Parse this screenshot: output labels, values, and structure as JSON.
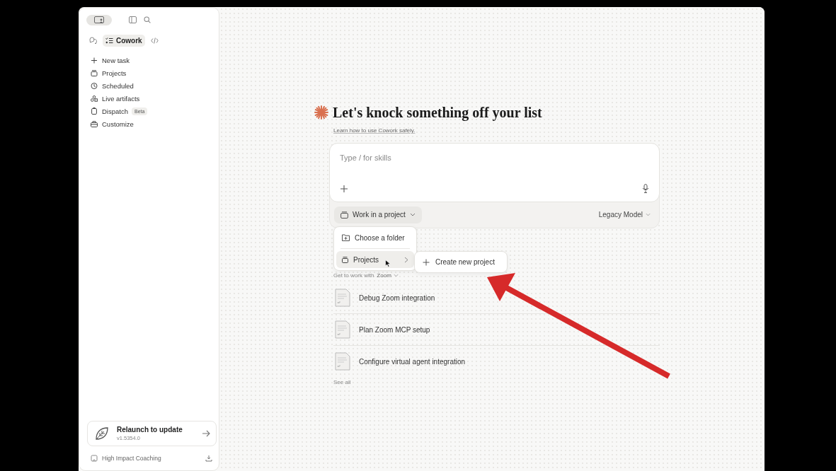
{
  "sidebar": {
    "view_toggle": {
      "on": true
    },
    "mode_tabs": [
      {
        "kind": "chat",
        "selected": false
      },
      {
        "kind": "cowork",
        "label": "Cowork",
        "selected": true
      },
      {
        "kind": "code",
        "selected": false
      }
    ],
    "nav_items": [
      {
        "kind": "plus",
        "label": "New task"
      },
      {
        "kind": "projects",
        "label": "Projects"
      },
      {
        "kind": "clock",
        "label": "Scheduled"
      },
      {
        "kind": "artifacts",
        "label": "Live artifacts"
      },
      {
        "kind": "dispatch",
        "label": "Dispatch",
        "badge": "Beta"
      },
      {
        "kind": "customize",
        "label": "Customize"
      }
    ],
    "update_card": {
      "title": "Relaunch to update",
      "version": "v1.5354.0"
    },
    "footer": {
      "label": "High Impact Coaching"
    }
  },
  "main": {
    "heading": "Let's knock something off your list",
    "safety_link": "Learn how to use Cowork safely.",
    "composer": {
      "placeholder": "Type / for skills",
      "project_button": "Work in a project",
      "model": "Legacy Model"
    },
    "project_menu": {
      "items": [
        {
          "kind": "folder",
          "label": "Choose a folder",
          "selected": false
        },
        {
          "kind": "projects",
          "label": "Projects",
          "selected": true
        }
      ],
      "submenu": [
        {
          "label": "Create new project"
        }
      ]
    },
    "suggestions": {
      "label": "Get to work with",
      "connector": "Zoom",
      "items": [
        {
          "label": "Debug Zoom integration"
        },
        {
          "label": "Plan Zoom MCP setup"
        },
        {
          "label": "Configure virtual agent integration"
        }
      ],
      "see_all": "See all"
    }
  }
}
